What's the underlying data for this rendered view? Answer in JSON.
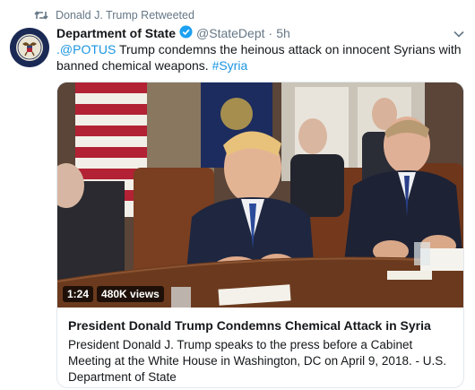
{
  "retweet": {
    "text": "Donald J. Trump Retweeted",
    "icon": "retweet-icon"
  },
  "tweet": {
    "display_name": "Department of State",
    "verified_icon": "verified-badge-icon",
    "handle": "@StateDept",
    "separator": "·",
    "time": "5h",
    "mention": ".@POTUS",
    "body": " Trump condemns the heinous attack on innocent Syrians with banned chemical weapons. ",
    "hashtag": "#Syria",
    "menu_icon": "chevron-down-icon"
  },
  "card": {
    "duration": "1:24",
    "views": "480K views",
    "title": "President Donald Trump Condemns Chemical Attack in Syria",
    "description": "President Donald J. Trump speaks to the press before a Cabinet Meeting at the White House in Washington, DC on April 9, 2018. - U.S. Department of State"
  },
  "colors": {
    "link": "#1b95e0",
    "verified": "#1da1f2",
    "secondary_text": "#657786",
    "border": "#e1e8ed"
  }
}
